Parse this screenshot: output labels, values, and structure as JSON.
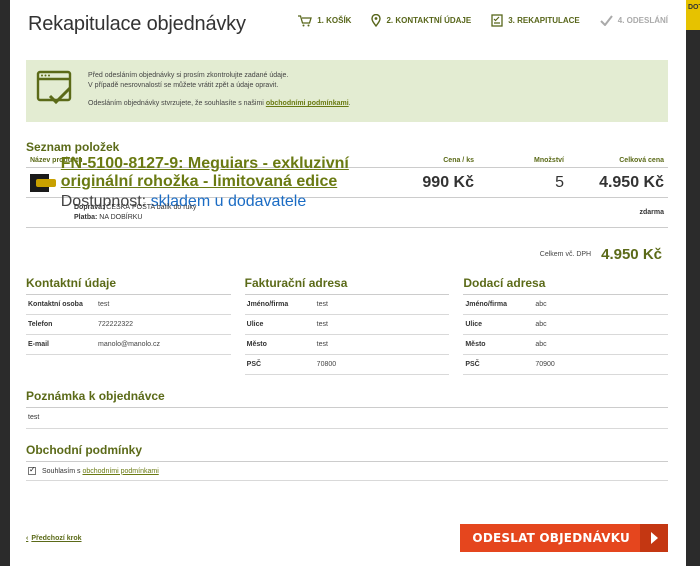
{
  "side_tab": "DOT",
  "title": "Rekapitulace objednávky",
  "steps": [
    {
      "label": "1. KOŠÍK",
      "icon": "cart-icon"
    },
    {
      "label": "2. KONTAKTNÍ ÚDAJE",
      "icon": "map-pin-icon"
    },
    {
      "label": "3. REKAPITULACE",
      "icon": "checklist-icon"
    },
    {
      "label": "4. ODESLÁNÍ",
      "icon": "check-icon"
    }
  ],
  "notice": {
    "line1": "Před odesláním objednávky si prosím zkontrolujte zadané údaje.",
    "line2": "V případě nesrovnalostí se můžete vrátit zpět a údaje opravit.",
    "line3_prefix": "Odesláním objednávky stvrzujete, že souhlasíte s našimi",
    "line3_link": "obchodními podmínkami",
    "line3_suffix": "."
  },
  "items": {
    "heading": "Seznam položek",
    "columns": {
      "name": "Název produktu",
      "price": "Cena / ks",
      "qty": "Množství",
      "total": "Celková cena"
    },
    "rows": [
      {
        "name": "FN-5100-8127-9: Meguiars - exkluzivní originální rohožka - limitovaná edice",
        "availability_label": "Dostupnost:",
        "availability_value": "skladem u dodavatele",
        "price": "990 Kč",
        "qty": "5",
        "total": "4.950 Kč"
      }
    ],
    "shipping_label": "Doprava:",
    "shipping_value": "ČESKÁ POŠTA balík do ruky",
    "payment_label": "Platba:",
    "payment_value": "NA DOBÍRKU",
    "shipping_price": "zdarma",
    "total_label": "Celkem vč. DPH",
    "total_value": "4.950 Kč"
  },
  "contact": {
    "heading": "Kontaktní údaje",
    "rows": [
      {
        "k": "Kontaktní osoba",
        "v": "test"
      },
      {
        "k": "Telefon",
        "v": "722222322"
      },
      {
        "k": "E-mail",
        "v": "manolo@manolo.cz"
      }
    ]
  },
  "billing": {
    "heading": "Fakturační adresa",
    "rows": [
      {
        "k": "Jméno/firma",
        "v": "test"
      },
      {
        "k": "Ulice",
        "v": "test"
      },
      {
        "k": "Město",
        "v": "test"
      },
      {
        "k": "PSČ",
        "v": "70800"
      }
    ]
  },
  "delivery": {
    "heading": "Dodací adresa",
    "rows": [
      {
        "k": "Jméno/firma",
        "v": "abc"
      },
      {
        "k": "Ulice",
        "v": "abc"
      },
      {
        "k": "Město",
        "v": "abc"
      },
      {
        "k": "PSČ",
        "v": "70900"
      }
    ]
  },
  "note": {
    "heading": "Poznámka k objednávce",
    "text": "test"
  },
  "terms": {
    "heading": "Obchodní podmínky",
    "prefix": "Souhlasím s",
    "link": "obchodními podmínkami",
    "checked": true
  },
  "footer": {
    "back": "Předchozí krok",
    "submit": "ODESLAT OBJEDNÁVKU"
  },
  "colors": {
    "accent": "#5b6a18",
    "notice_bg": "#e3ecd2",
    "submit": "#e5461e"
  }
}
